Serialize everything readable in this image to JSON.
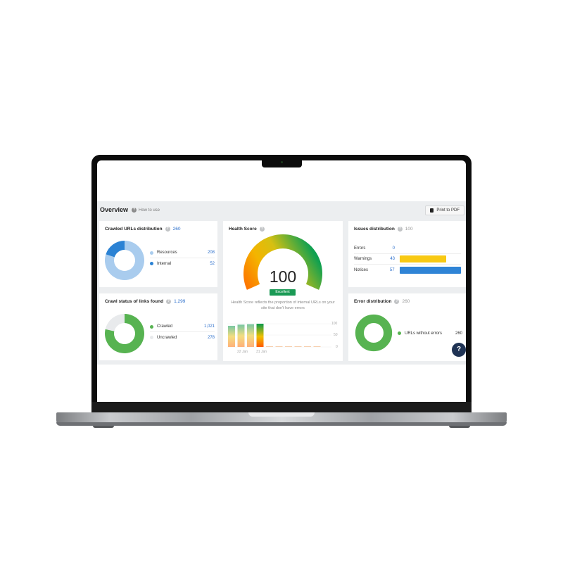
{
  "overview": {
    "title": "Overview",
    "how_to_use": "How to use",
    "print_label": "Print to PDF",
    "help_label": "?"
  },
  "crawled_urls": {
    "title": "Crawled URLs distribution",
    "total": "260",
    "items": [
      {
        "label": "Resources",
        "value": "208",
        "color": "#a9ccee"
      },
      {
        "label": "Internal",
        "value": "52",
        "color": "#2b82d4"
      }
    ]
  },
  "crawl_status": {
    "title": "Crawl status of links found",
    "total": "1,299",
    "items": [
      {
        "label": "Crawled",
        "value": "1,021",
        "color": "#57b351"
      },
      {
        "label": "Uncrawled",
        "value": "278",
        "color": "#e8eaec"
      }
    ]
  },
  "health_score": {
    "title": "Health Score",
    "score": "100",
    "badge": "Excellent",
    "description": "Health Score reflects the proportion of internal URLs on your site that don't have errors",
    "history": {
      "x_labels": [
        "22 Jan",
        "31 Jan"
      ],
      "y_ticks": [
        "100",
        "50",
        "0"
      ],
      "values": [
        91,
        96,
        98,
        100
      ],
      "empty_points": 6
    }
  },
  "issues": {
    "title": "Issues distribution",
    "total": "100",
    "rows": [
      {
        "label": "Errors",
        "value": "0",
        "percent": 0,
        "color": "#e04a3b"
      },
      {
        "label": "Warnings",
        "value": "43",
        "percent": 43,
        "color": "#f8c913"
      },
      {
        "label": "Notices",
        "value": "57",
        "percent": 57,
        "color": "#2f84d6"
      }
    ]
  },
  "error_distribution": {
    "title": "Error distribution",
    "total": "260",
    "items": [
      {
        "label": "URLs without errors",
        "value": "260",
        "color": "#57b351"
      }
    ]
  }
}
